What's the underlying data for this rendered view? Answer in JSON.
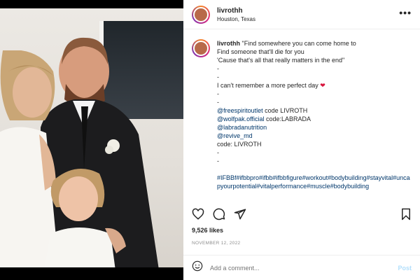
{
  "post": {
    "username": "livrothh",
    "location": "Houston, Texas",
    "more_icon": "more-horizontal-icon",
    "caption": {
      "username": "livrothh",
      "lines": [
        "\"Find somewhere you can come home to",
        "Find someone that'll die for you",
        "'Cause that's all that really matters in the end\"",
        "-",
        "-",
        "I can't remember a more perfect day",
        "-",
        "-"
      ],
      "heart": "❤",
      "sponsor_lines": [
        {
          "handle": "@freespiritoutlet",
          "suffix": " code LIVROTH"
        },
        {
          "handle": "@wolfpak.official",
          "suffix": " code:LABRADA"
        },
        {
          "handle": "@labradanutrition",
          "suffix": ""
        },
        {
          "handle": "@revive_md",
          "suffix": ""
        }
      ],
      "code_line": "code: LIVROTH",
      "trailing_dashes": [
        "-",
        "-"
      ],
      "hashtags": "#IFBBf#ifbbpro#ifbb#ifbbfigure#workout#bodybuilding#stayvital#uncapyourpotential#vitalperformance#muscle#bodybuilding"
    },
    "likes": "9,526 likes",
    "date": "NOVEMBER 12, 2022",
    "comment_placeholder": "Add a comment...",
    "post_label": "Post",
    "colors": {
      "link": "#00376b",
      "heart": "#d8153d",
      "post_button": "#b2dffc"
    }
  }
}
